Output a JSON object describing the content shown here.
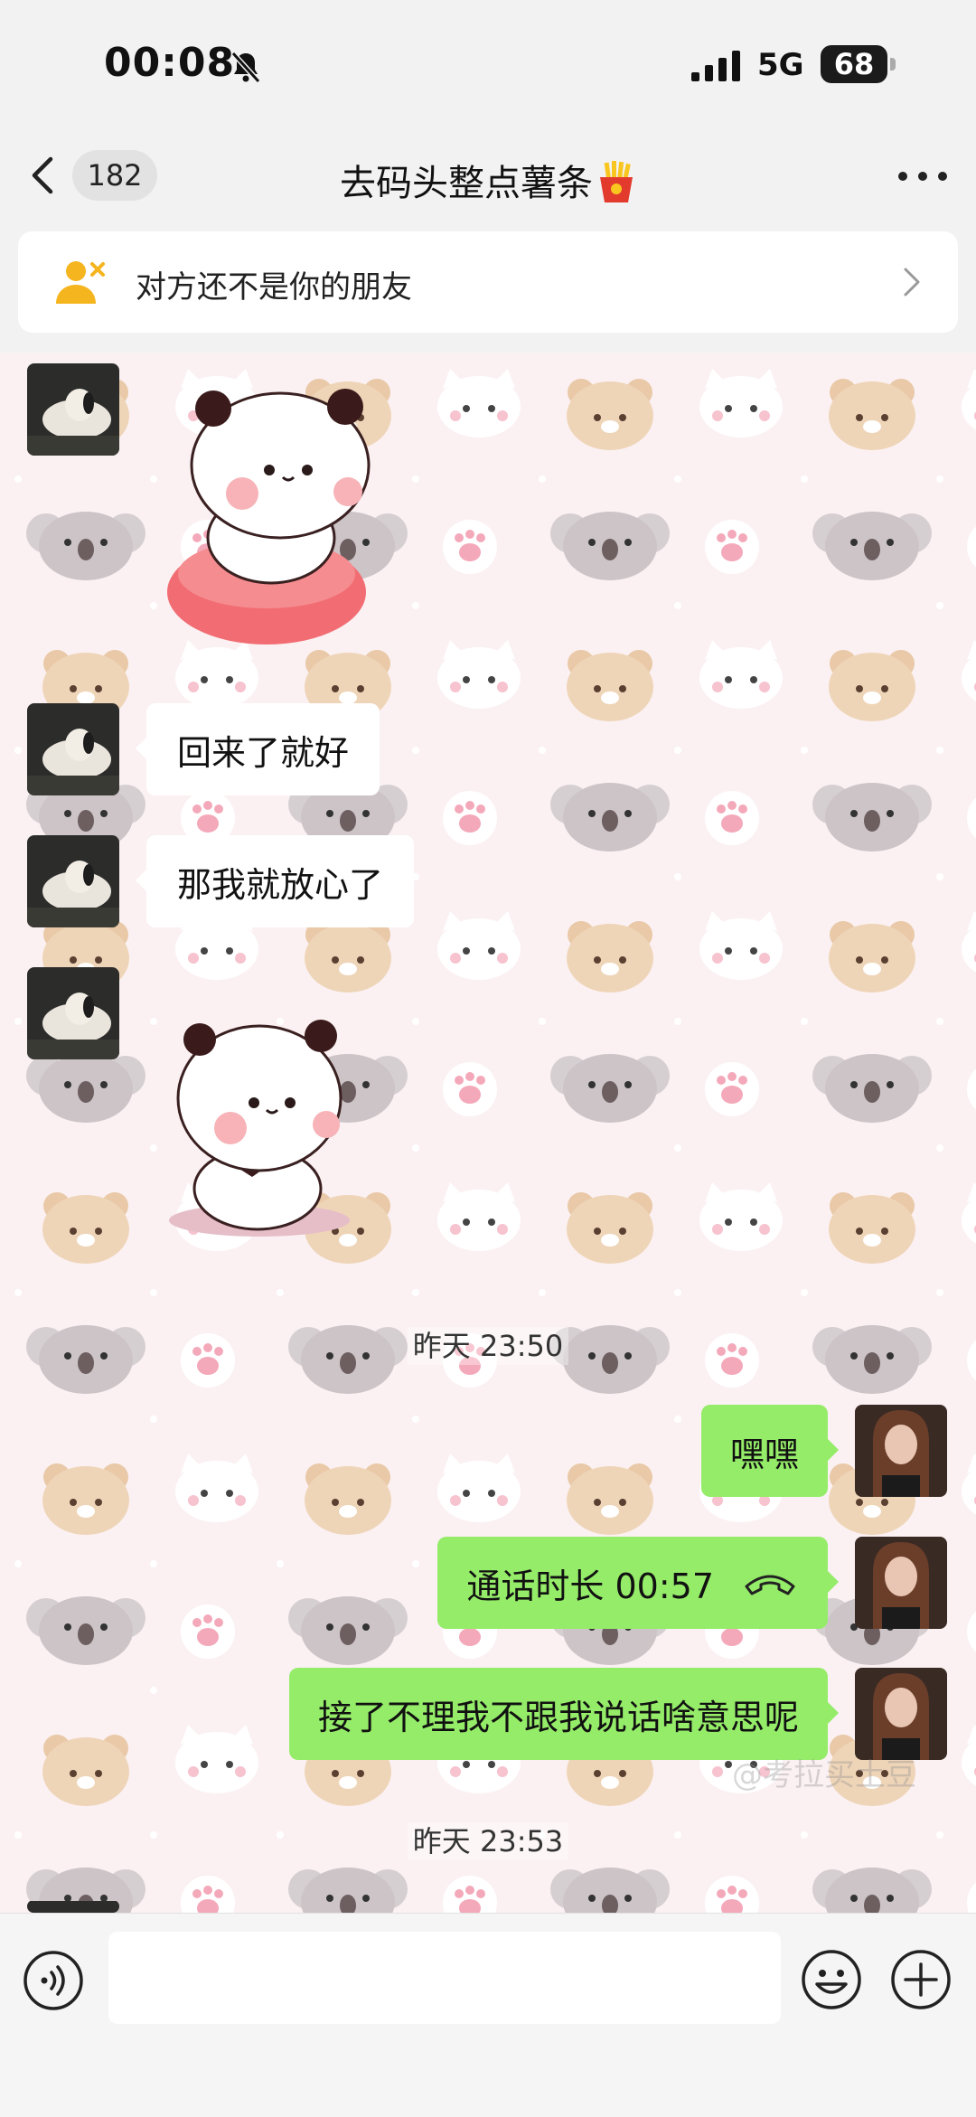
{
  "status_bar": {
    "time": "00:08",
    "network": "5G",
    "battery": "68"
  },
  "nav": {
    "unread_count": "182",
    "title": "去码头整点薯条",
    "title_emoji": "fries-emoji"
  },
  "notice": {
    "text": "对方还不是你的朋友",
    "icon": "add-friend-icon"
  },
  "messages": [
    {
      "type": "sticker",
      "side": "left",
      "sticker": "panda-sitting-on-cushion"
    },
    {
      "type": "text",
      "side": "left",
      "text": "回来了就好"
    },
    {
      "type": "text",
      "side": "left",
      "text": "那我就放心了"
    },
    {
      "type": "sticker",
      "side": "left",
      "sticker": "panda-sitting"
    },
    {
      "type": "time",
      "text": "昨天 23:50"
    },
    {
      "type": "text",
      "side": "right",
      "text": "嘿嘿"
    },
    {
      "type": "call",
      "side": "right",
      "text": "通话时长 00:57"
    },
    {
      "type": "text",
      "side": "right",
      "text": "接了不理我不跟我说话啥意思呢"
    },
    {
      "type": "time",
      "text": "昨天 23:53"
    }
  ],
  "watermark": "@考拉买土豆",
  "input": {
    "placeholder": ""
  },
  "colors": {
    "outgoing_bubble": "#95ec69",
    "incoming_bubble": "#ffffff",
    "chat_bg": "#fbf1f3"
  }
}
